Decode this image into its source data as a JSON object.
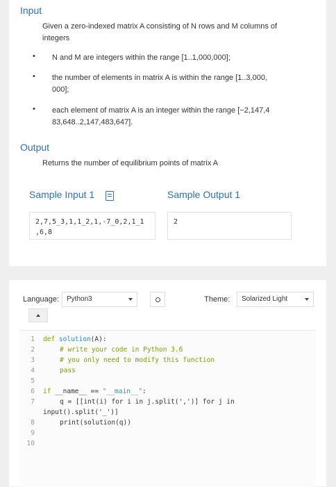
{
  "problem": {
    "input_heading": "Input",
    "input_intro_1": "Given a zero-indexed matrix A consisting of N rows and M columns of",
    "input_intro_2": "integers",
    "bullets": [
      {
        "line1": "N and M are integers within the range [1..1,000,000];",
        "line2": ""
      },
      {
        "line1": "the number of elements in matrix A is within the range [1..3,000,",
        "line2": "000];"
      },
      {
        "line1": "each element of matrix A is an integer within the range [−2,147,4",
        "line2": "83,648..2,147,483,647]."
      }
    ],
    "bullet_symbol": "•",
    "output_heading": "Output",
    "output_text": "Returns the number of equilibrium points of matrix A",
    "sample_input_title": "Sample Input 1",
    "sample_output_title": "Sample Output 1",
    "sample_input_line1": "2,7,5_3,1,1_2,1,-7_0,2,1_1",
    "sample_input_line2": ",6,8",
    "sample_output_value": "2"
  },
  "editor": {
    "language_label": "Language:",
    "language_value": "Python3",
    "theme_label": "Theme:",
    "theme_value": "Solarized Light",
    "line_numbers": [
      "1",
      "2",
      "3",
      "4",
      "5",
      "6",
      "7",
      "",
      "8",
      "9",
      "10"
    ],
    "code": {
      "l1_kw": "def",
      "l1_fn": "solution",
      "l1_rest": "(A):",
      "l2": "# write your code in Python 3.6",
      "l3": "# you only need to modify this function",
      "l4": "pass",
      "l6_kw": "if",
      "l6_a": "__name__",
      "l6_op": " == ",
      "l6_str": "\"__main__\"",
      "l6_end": ":",
      "l7": "q = [[int(i) for i in j.split(',')] for j in",
      "l7b": "input().split('_')]",
      "l8": "print(solution(q))"
    }
  }
}
